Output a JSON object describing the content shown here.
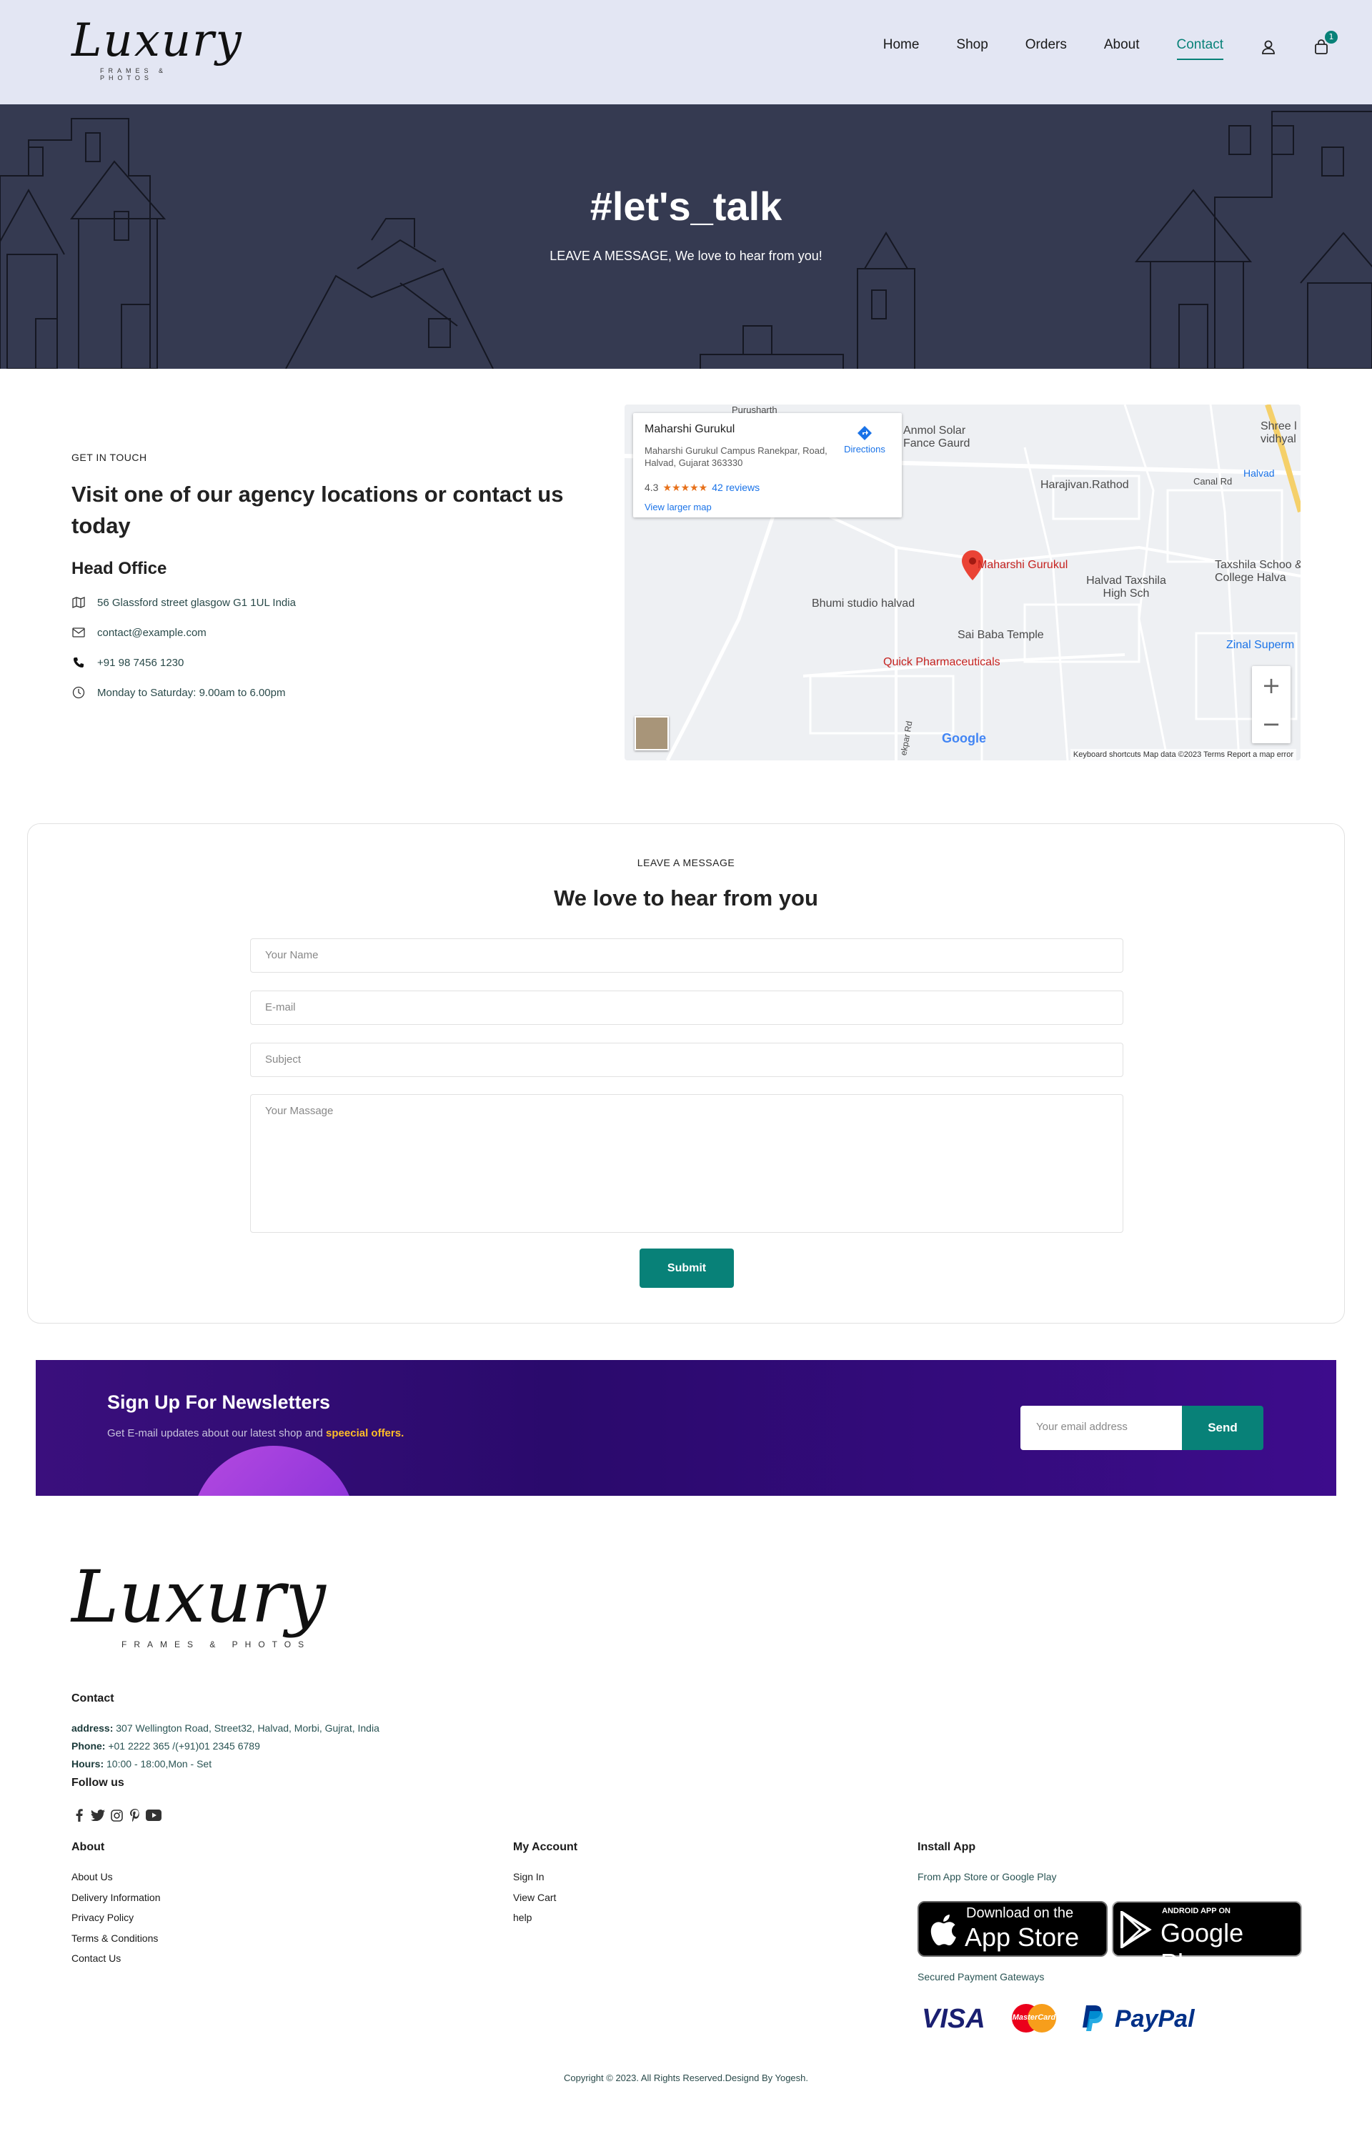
{
  "header": {
    "logo_text": "Luxury",
    "logo_sub": "FRAMES & PHOTOS",
    "nav": [
      {
        "label": "Home"
      },
      {
        "label": "Shop"
      },
      {
        "label": "Orders"
      },
      {
        "label": "About"
      },
      {
        "label": "Contact"
      }
    ],
    "cart_count": "1",
    "accent_color": "#088178"
  },
  "hero": {
    "title": "#let's_talk",
    "subtitle": "LEAVE A MESSAGE, We love to hear from you!"
  },
  "contact": {
    "eyebrow": "GET IN TOUCH",
    "heading": "Visit one of our agency locations or contact us today",
    "office_title": "Head Office",
    "address": "56 Glassford street glasgow G1 1UL India",
    "email": "contact@example.com",
    "phone": "+91 98 7456 1230",
    "hours": "Monday to Saturday: 9.00am to 6.00pm"
  },
  "map": {
    "place_name": "Maharshi Gurukul",
    "place_address": "Maharshi Gurukul Campus Ranekpar, Road, Halvad, Gujarat 363330",
    "rating": "4.3",
    "stars": "★★★★★",
    "reviews": "42 reviews",
    "larger_map": "View larger map",
    "directions": "Directions",
    "labels": {
      "marker": "Maharshi Gurukul",
      "anmol": "Anmol Solar Fance Gaurd",
      "harajivan": "Harajivan.Rathod",
      "canal": "Canal Rd",
      "shree": "Shree l vidhyal",
      "halvad": "Halvad",
      "taxshila": "Taxshila Schoo & College Halva",
      "halvad_tax": "Halvad Taxshila High Sch",
      "bhumi": "Bhumi studio halvad",
      "saibaba": "Sai Baba Temple",
      "quick": "Quick Pharmaceuticals",
      "zinal": "Zinal Superm",
      "purusharth": "Purusharth",
      "road": "ekpar Rd"
    },
    "google": "Google",
    "footer": "Keyboard shortcuts   Map data ©2023   Terms   Report a map error"
  },
  "form": {
    "eyebrow": "LEAVE A MESSAGE",
    "title": "We love to hear from you",
    "name_placeholder": "Your Name",
    "email_placeholder": "E-mail",
    "subject_placeholder": "Subject",
    "message_placeholder": "Your Massage",
    "submit": "Submit"
  },
  "newsletter": {
    "title": "Sign Up For Newsletters",
    "text": "Get E-mail updates about our latest shop and ",
    "highlight": "speecial offers.",
    "placeholder": "Your email address",
    "button": "Send"
  },
  "footer": {
    "logo_text": "Luxury",
    "logo_sub": "FRAMES & PHOTOS",
    "contact_title": "Contact",
    "address_label": "address:",
    "address": " 307 Wellington Road, Street32, Halvad, Morbi, Gujrat, India",
    "phone_label": "Phone:",
    "phone": " +01 2222 365 /(+91)01 2345 6789",
    "hours_label": "Hours:",
    "hours": " 10:00 - 18:00,Mon - Set",
    "follow_title": "Follow us",
    "social_icons": [
      "facebook-icon",
      "twitter-icon",
      "instagram-icon",
      "pinterest-icon",
      "youtube-icon"
    ],
    "about_title": "About",
    "about_links": [
      "About Us",
      "Delivery Information",
      "Privacy Policy",
      "Terms & Conditions",
      "Contact Us"
    ],
    "account_title": "My Account",
    "account_links": [
      "Sign In",
      "View Cart",
      "help"
    ],
    "install_title": "Install App",
    "install_text": "From App Store or Google Play",
    "appstore_small": "Download on the",
    "appstore_big": "App Store",
    "gplay_small": "ANDROID APP ON",
    "gplay_big": "Google Play",
    "payment_text": "Secured Payment Gateways",
    "payments": [
      "VISA",
      "MasterCard",
      "PayPal"
    ],
    "copyright": "Copyright © 2023. All Rights Reserved.Designd By Yogesh."
  }
}
